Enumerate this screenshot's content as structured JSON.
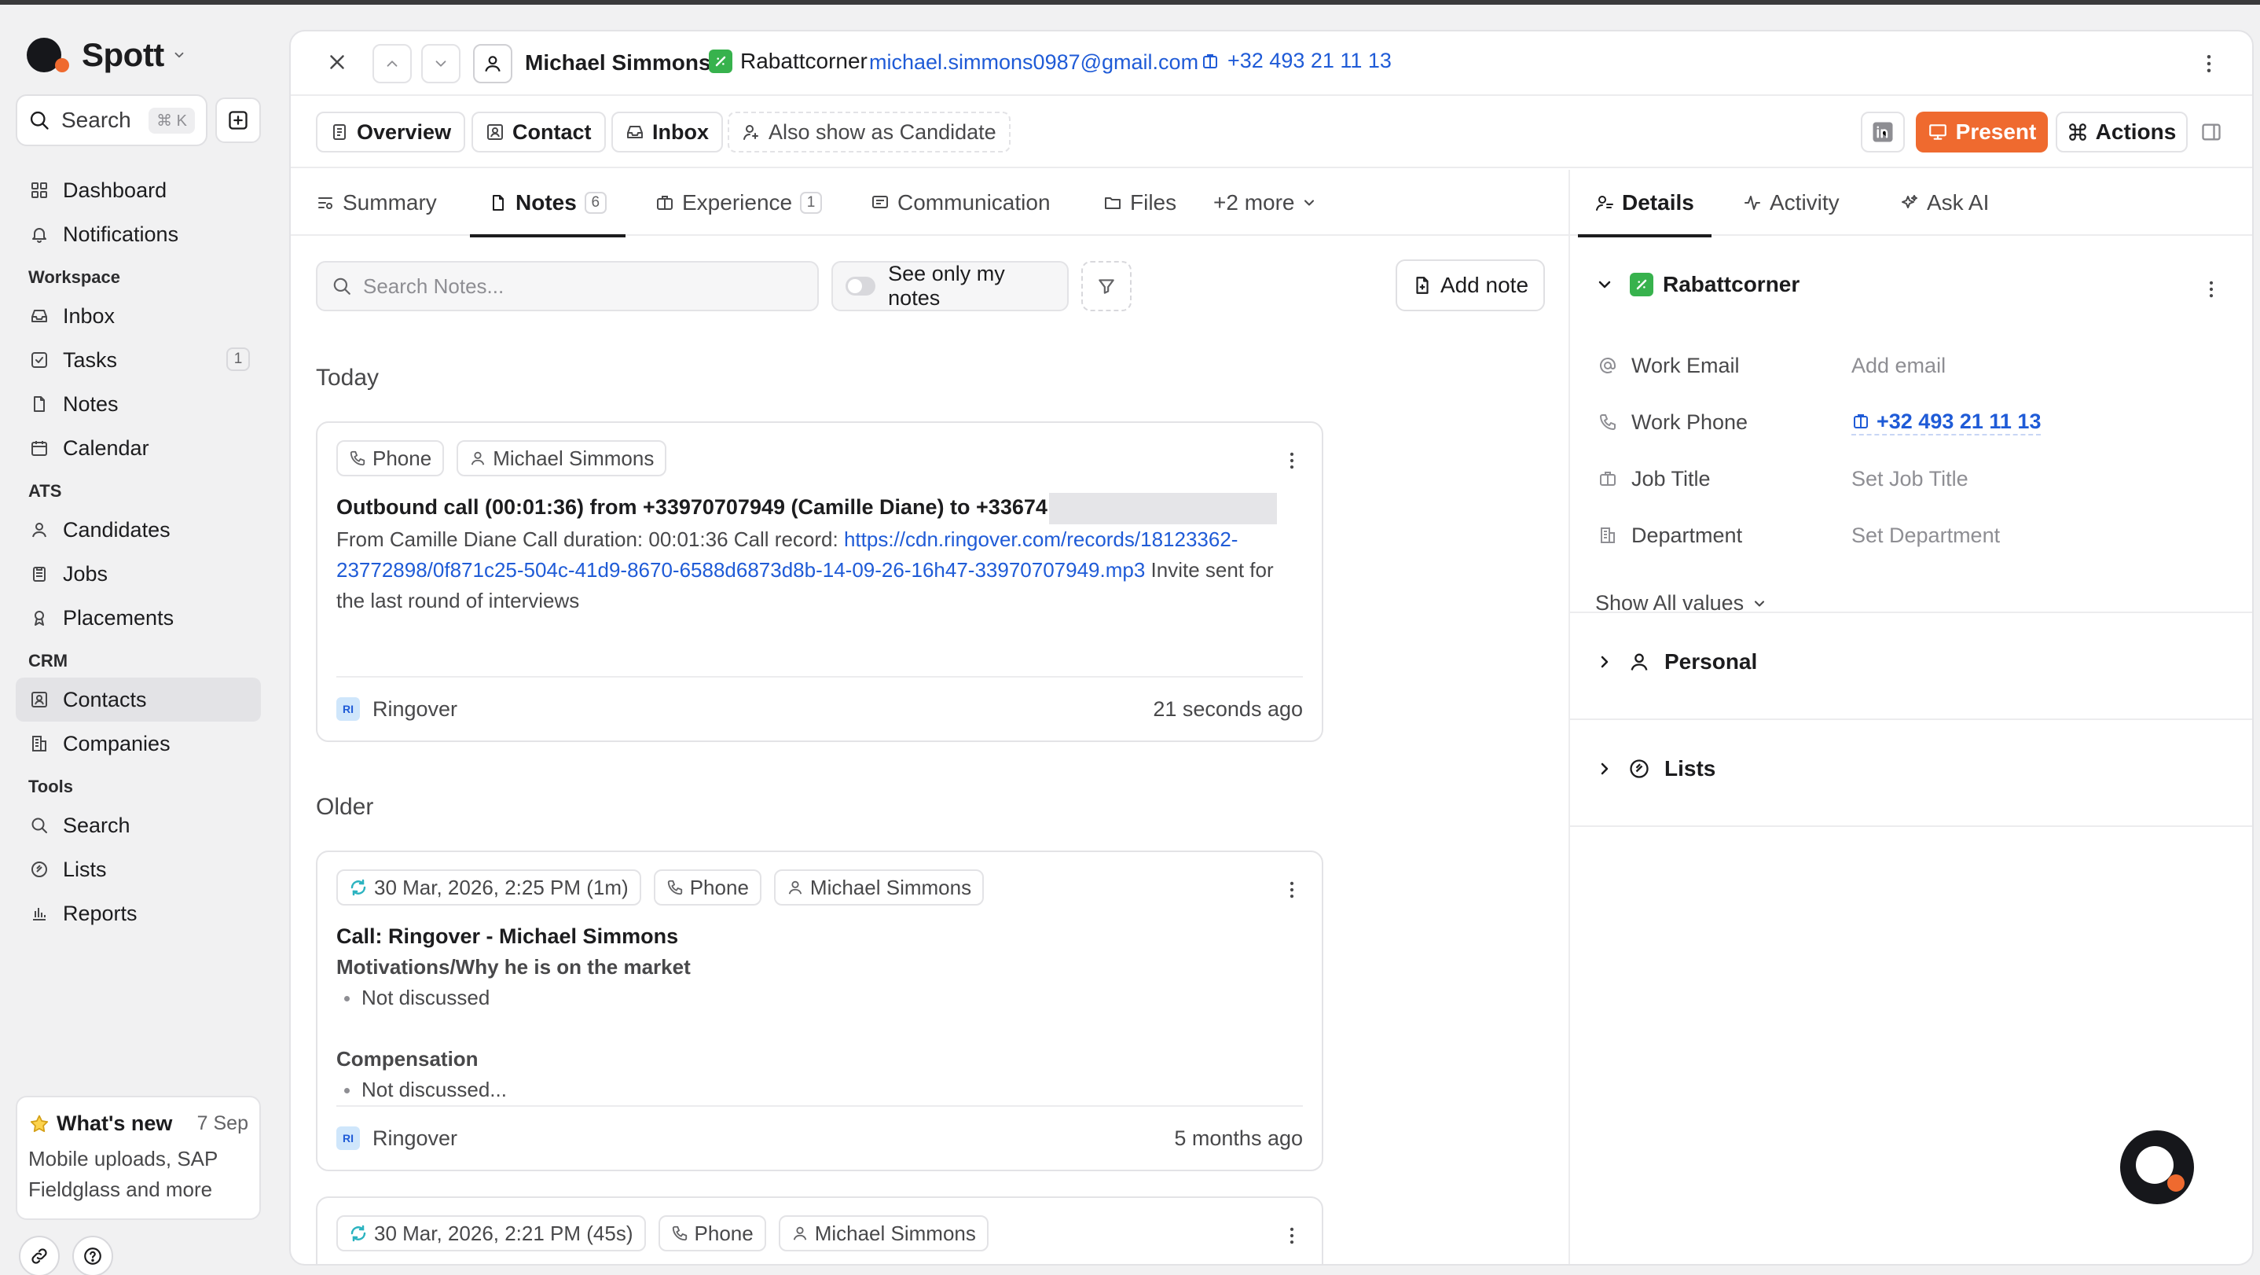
{
  "app": {
    "brand": "Spott",
    "search_label": "Search",
    "search_shortcut": "⌘ K"
  },
  "sidebar": {
    "items_top": [
      {
        "label": "Dashboard",
        "icon": "dashboard-icon"
      },
      {
        "label": "Notifications",
        "icon": "bell-icon"
      }
    ],
    "sections": [
      {
        "title": "Workspace",
        "items": [
          {
            "label": "Inbox",
            "icon": "inbox-icon"
          },
          {
            "label": "Tasks",
            "icon": "checkbox-icon",
            "badge": "1"
          },
          {
            "label": "Notes",
            "icon": "note-icon"
          },
          {
            "label": "Calendar",
            "icon": "calendar-icon"
          }
        ]
      },
      {
        "title": "ATS",
        "items": [
          {
            "label": "Candidates",
            "icon": "person-icon"
          },
          {
            "label": "Jobs",
            "icon": "clipboard-icon"
          },
          {
            "label": "Placements",
            "icon": "ribbon-icon"
          }
        ]
      },
      {
        "title": "CRM",
        "items": [
          {
            "label": "Contacts",
            "icon": "contact-card-icon",
            "active": true
          },
          {
            "label": "Companies",
            "icon": "building-icon"
          }
        ]
      },
      {
        "title": "Tools",
        "items": [
          {
            "label": "Search",
            "icon": "search-icon"
          },
          {
            "label": "Lists",
            "icon": "list-circle-icon"
          },
          {
            "label": "Reports",
            "icon": "bar-chart-icon"
          }
        ]
      }
    ],
    "whats_new": {
      "title": "What's new",
      "date": "7 Sep",
      "body": "Mobile uploads, SAP Fieldglass and more"
    }
  },
  "record": {
    "name": "Michael Simmons",
    "company": "Rabattcorner",
    "email": "michael.simmons0987@gmail.com",
    "phone": "+32 493 21 11 13"
  },
  "toolbar": {
    "overview": "Overview",
    "contact": "Contact",
    "inbox": "Inbox",
    "also_candidate": "Also show as Candidate",
    "present": "Present",
    "actions": "Actions"
  },
  "tabs": {
    "summary": "Summary",
    "notes": "Notes",
    "notes_count": "6",
    "experience": "Experience",
    "experience_count": "1",
    "communication": "Communication",
    "files": "Files",
    "more": "+2 more"
  },
  "notes": {
    "search_placeholder": "Search Notes...",
    "only_mine": "See only my notes",
    "add_note": "Add note",
    "today_label": "Today",
    "older_label": "Older",
    "cards": [
      {
        "chips": [
          "Phone",
          "Michael Simmons"
        ],
        "title": "Outbound call (00:01:36) from +33970707949 (Camille Diane) to +33674",
        "text_before_link": "From Camille Diane Call duration: 00:01:36 Call record: ",
        "link": "https://cdn.ringover.com/records/18123362-23772898/0f871c25-504c-41d9-8670-6588d6873d8b-14-09-26-16h47-33970707949.mp3",
        "text_after_link": " Invite sent for the last round of interviews",
        "source": "Ringover",
        "source_badge": "RI",
        "time": "21 seconds ago"
      },
      {
        "chips": [
          "30 Mar, 2026, 2:25 PM (1m)",
          "Phone",
          "Michael Simmons"
        ],
        "title": "Call: Ringover - Michael Simmons",
        "section1": "Motivations/Why he is on the market",
        "bullet1": "Not discussed",
        "section2": "Compensation",
        "bullet2": "Not discussed...",
        "source": "Ringover",
        "source_badge": "RI",
        "time": "5 months ago"
      },
      {
        "chips": [
          "30 Mar, 2026, 2:21 PM (45s)",
          "Phone",
          "Michael Simmons"
        ]
      }
    ]
  },
  "details": {
    "tabs": [
      "Details",
      "Activity",
      "Ask AI"
    ],
    "company": "Rabattcorner",
    "fields": [
      {
        "label": "Work Email",
        "value": "Add email",
        "icon": "at-icon"
      },
      {
        "label": "Work Phone",
        "value": "+32 493 21 11 13",
        "icon": "phone-icon"
      },
      {
        "label": "Job Title",
        "value": "Set Job Title",
        "icon": "briefcase-icon"
      },
      {
        "label": "Department",
        "value": "Set Department",
        "icon": "building-icon"
      }
    ],
    "show_all": "Show All values",
    "personal": "Personal",
    "lists": "Lists"
  },
  "colors": {
    "accent": "#ef6a2f",
    "link": "#1f5bd7",
    "company_green": "#37b24d"
  }
}
